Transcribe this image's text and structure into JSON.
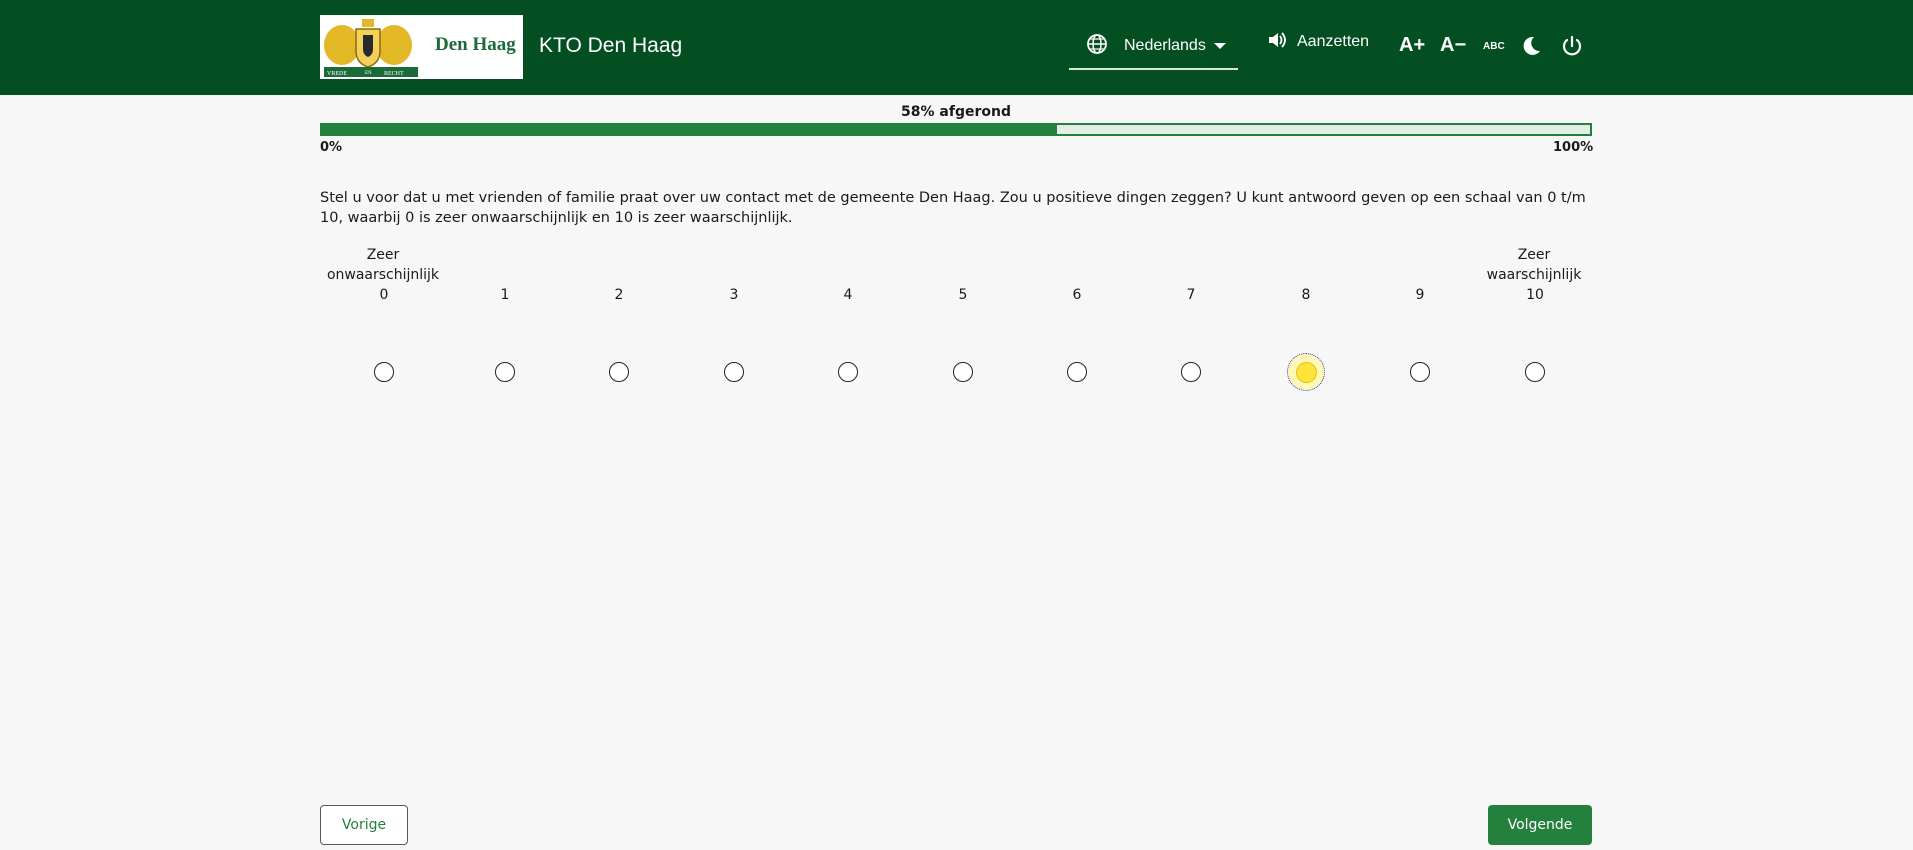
{
  "header": {
    "logo_text": "Den Haag",
    "logo_motto": [
      "VREDE",
      "EN",
      "RECHT"
    ],
    "app_title": "KTO Den Haag",
    "language": {
      "icon": "globe-icon",
      "selected": "Nederlands"
    },
    "speech": {
      "icon": "speaker-icon",
      "label": "Aanzetten"
    },
    "font_increase": "A+",
    "font_decrease": "A−",
    "dyslexia_font": "ABC",
    "dark_mode_icon": "moon-icon",
    "logout_icon": "power-icon",
    "colors": {
      "header_bg": "#034f22",
      "accent": "#23813d"
    }
  },
  "progress": {
    "label": "58% afgerond",
    "percent": 58,
    "min_label": "0%",
    "max_label": "100%"
  },
  "question": {
    "text": "Stel u voor dat u met vrienden of familie praat over uw contact met de gemeente Den Haag. Zou u positieve dingen zeggen? U kunt antwoord geven op een schaal van 0 t/m 10, waarbij 0 is zeer onwaarschijnlijk en 10 is zeer waarschijnlijk."
  },
  "scale": {
    "low_anchor": [
      "Zeer",
      "onwaarschijnlijk"
    ],
    "high_anchor": [
      "Zeer",
      "waarschijnlijk"
    ],
    "options": [
      "0",
      "1",
      "2",
      "3",
      "4",
      "5",
      "6",
      "7",
      "8",
      "9",
      "10"
    ],
    "selected": "8"
  },
  "nav": {
    "prev_label": "Vorige",
    "next_label": "Volgende"
  }
}
